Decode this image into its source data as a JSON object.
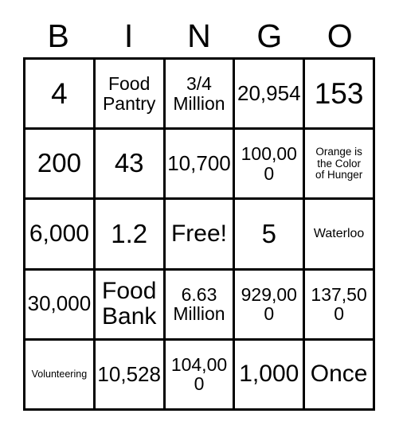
{
  "card": {
    "title_letters": [
      "B",
      "I",
      "N",
      "G",
      "O"
    ],
    "free_space_label": "Free!",
    "rows": [
      [
        {
          "text": "4",
          "size": "fs-xxl"
        },
        {
          "text": "Food\nPantry",
          "size": "fs-sm"
        },
        {
          "text": "3/4\nMillion",
          "size": "fs-sm"
        },
        {
          "text": "20,954",
          "size": "fs-md"
        },
        {
          "text": "153",
          "size": "fs-xxl"
        }
      ],
      [
        {
          "text": "200",
          "size": "fs-xl"
        },
        {
          "text": "43",
          "size": "fs-xl"
        },
        {
          "text": "10,700",
          "size": "fs-md"
        },
        {
          "text": "100,000",
          "size": "fs-sm"
        },
        {
          "text": "Orange is\nthe Color\nof Hunger",
          "size": "fs-xxs"
        }
      ],
      [
        {
          "text": "6,000",
          "size": "fs-lg"
        },
        {
          "text": "1.2",
          "size": "fs-xl"
        },
        {
          "text": "Free!",
          "size": "fs-lg"
        },
        {
          "text": "5",
          "size": "fs-xl"
        },
        {
          "text": "Waterloo",
          "size": "fs-xs"
        }
      ],
      [
        {
          "text": "30,000",
          "size": "fs-md"
        },
        {
          "text": "Food\nBank",
          "size": "fs-lg"
        },
        {
          "text": "6.63\nMillion",
          "size": "fs-sm"
        },
        {
          "text": "929,000",
          "size": "fs-sm"
        },
        {
          "text": "137,500",
          "size": "fs-sm"
        }
      ],
      [
        {
          "text": "Volunteering",
          "size": "fs-tiny"
        },
        {
          "text": "10,528",
          "size": "fs-md"
        },
        {
          "text": "104,000",
          "size": "fs-sm"
        },
        {
          "text": "1,000",
          "size": "fs-lg"
        },
        {
          "text": "Once",
          "size": "fs-lg"
        }
      ]
    ]
  },
  "colors": {
    "grid_line": "#000000",
    "text": "#000000",
    "background": "#ffffff"
  }
}
